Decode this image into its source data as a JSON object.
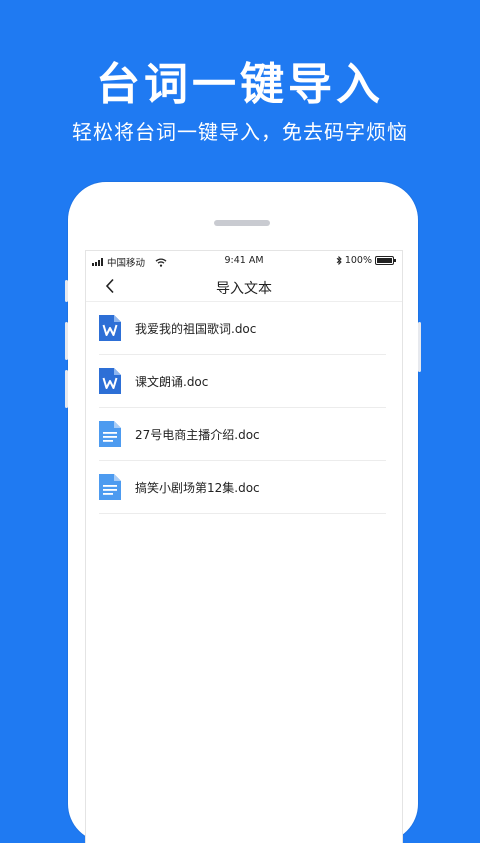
{
  "promo": {
    "headline": "台词一键导入",
    "subline": "轻松将台词一键导入，免去码字烦恼"
  },
  "status_bar": {
    "carrier": "中国移动",
    "time": "9:41 AM",
    "battery": "100%",
    "icons": [
      "signal-bars-icon",
      "wifi-icon",
      "bluetooth-icon",
      "battery-icon"
    ]
  },
  "nav": {
    "title": "导入文本",
    "back_icon": "chevron-left-icon"
  },
  "files": [
    {
      "name": "我爱我的祖国歌词.doc",
      "icon": "word-doc-icon"
    },
    {
      "name": "课文朗诵.doc",
      "icon": "word-doc-icon"
    },
    {
      "name": "27号电商主播介绍.doc",
      "icon": "text-doc-icon"
    },
    {
      "name": "搞笑小剧场第12集.doc",
      "icon": "text-doc-icon"
    }
  ],
  "colors": {
    "background": "#1f7af2",
    "word_icon": "#2d6fd6",
    "text_icon": "#4d9bf0"
  }
}
